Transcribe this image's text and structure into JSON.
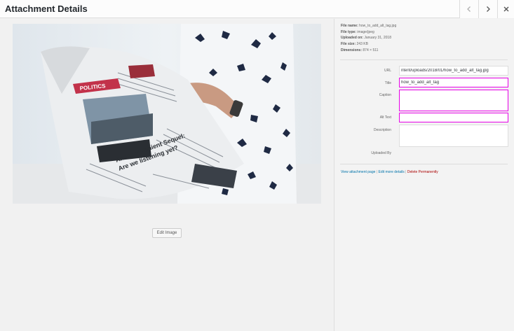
{
  "header": {
    "title": "Attachment Details",
    "prev_icon": "chevron-left-icon",
    "next_icon": "chevron-right-icon",
    "close_icon": "close-icon"
  },
  "image": {
    "headline_1": "POLITICS",
    "headline_2": "An Inconvenient Sequel:",
    "headline_3": "Are we listening yet?",
    "edit_label": "Edit Image"
  },
  "details": {
    "file_name_label": "File name:",
    "file_name": "how_to_add_alt_tag.jpg",
    "file_type_label": "File type:",
    "file_type": "image/jpeg",
    "uploaded_on_label": "Uploaded on:",
    "uploaded_on": "January 31, 2018",
    "file_size_label": "File size:",
    "file_size": "243 KB",
    "dimensions_label": "Dimensions:",
    "dimensions": "874 × 511"
  },
  "fields": {
    "url_label": "URL",
    "url_value": "ntent/uploads/2018/01/how_to_add_alt_tag.jpg",
    "title_label": "Title",
    "title_value": "how_to_add_alt_tag",
    "caption_label": "Caption",
    "caption_value": "",
    "alt_label": "Alt Text",
    "alt_value": "",
    "description_label": "Description",
    "description_value": "",
    "uploaded_by_label": "Uploaded By"
  },
  "actions": {
    "view_page": "View attachment page",
    "edit_details": "Edit more details",
    "delete": "Delete Permanently",
    "separator": "|"
  },
  "colors": {
    "highlight": "#e600e6",
    "link": "#0073aa",
    "delete": "#aa0000"
  }
}
